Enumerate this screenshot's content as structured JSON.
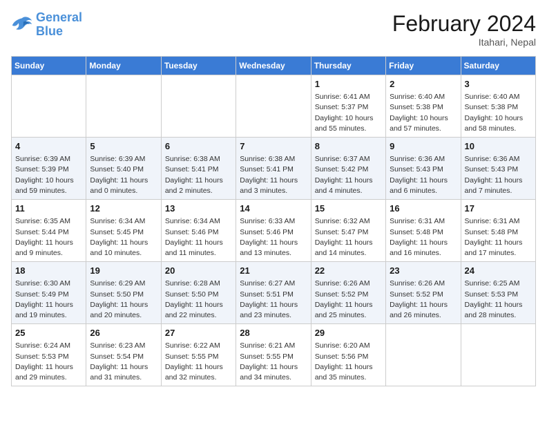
{
  "logo": {
    "text_general": "General",
    "text_blue": "Blue"
  },
  "title": "February 2024",
  "subtitle": "Itahari, Nepal",
  "days_of_week": [
    "Sunday",
    "Monday",
    "Tuesday",
    "Wednesday",
    "Thursday",
    "Friday",
    "Saturday"
  ],
  "weeks": [
    [
      {
        "day": "",
        "info": ""
      },
      {
        "day": "",
        "info": ""
      },
      {
        "day": "",
        "info": ""
      },
      {
        "day": "",
        "info": ""
      },
      {
        "day": "1",
        "info": "Sunrise: 6:41 AM\nSunset: 5:37 PM\nDaylight: 10 hours and 55 minutes."
      },
      {
        "day": "2",
        "info": "Sunrise: 6:40 AM\nSunset: 5:38 PM\nDaylight: 10 hours and 57 minutes."
      },
      {
        "day": "3",
        "info": "Sunrise: 6:40 AM\nSunset: 5:38 PM\nDaylight: 10 hours and 58 minutes."
      }
    ],
    [
      {
        "day": "4",
        "info": "Sunrise: 6:39 AM\nSunset: 5:39 PM\nDaylight: 10 hours and 59 minutes."
      },
      {
        "day": "5",
        "info": "Sunrise: 6:39 AM\nSunset: 5:40 PM\nDaylight: 11 hours and 0 minutes."
      },
      {
        "day": "6",
        "info": "Sunrise: 6:38 AM\nSunset: 5:41 PM\nDaylight: 11 hours and 2 minutes."
      },
      {
        "day": "7",
        "info": "Sunrise: 6:38 AM\nSunset: 5:41 PM\nDaylight: 11 hours and 3 minutes."
      },
      {
        "day": "8",
        "info": "Sunrise: 6:37 AM\nSunset: 5:42 PM\nDaylight: 11 hours and 4 minutes."
      },
      {
        "day": "9",
        "info": "Sunrise: 6:36 AM\nSunset: 5:43 PM\nDaylight: 11 hours and 6 minutes."
      },
      {
        "day": "10",
        "info": "Sunrise: 6:36 AM\nSunset: 5:43 PM\nDaylight: 11 hours and 7 minutes."
      }
    ],
    [
      {
        "day": "11",
        "info": "Sunrise: 6:35 AM\nSunset: 5:44 PM\nDaylight: 11 hours and 9 minutes."
      },
      {
        "day": "12",
        "info": "Sunrise: 6:34 AM\nSunset: 5:45 PM\nDaylight: 11 hours and 10 minutes."
      },
      {
        "day": "13",
        "info": "Sunrise: 6:34 AM\nSunset: 5:46 PM\nDaylight: 11 hours and 11 minutes."
      },
      {
        "day": "14",
        "info": "Sunrise: 6:33 AM\nSunset: 5:46 PM\nDaylight: 11 hours and 13 minutes."
      },
      {
        "day": "15",
        "info": "Sunrise: 6:32 AM\nSunset: 5:47 PM\nDaylight: 11 hours and 14 minutes."
      },
      {
        "day": "16",
        "info": "Sunrise: 6:31 AM\nSunset: 5:48 PM\nDaylight: 11 hours and 16 minutes."
      },
      {
        "day": "17",
        "info": "Sunrise: 6:31 AM\nSunset: 5:48 PM\nDaylight: 11 hours and 17 minutes."
      }
    ],
    [
      {
        "day": "18",
        "info": "Sunrise: 6:30 AM\nSunset: 5:49 PM\nDaylight: 11 hours and 19 minutes."
      },
      {
        "day": "19",
        "info": "Sunrise: 6:29 AM\nSunset: 5:50 PM\nDaylight: 11 hours and 20 minutes."
      },
      {
        "day": "20",
        "info": "Sunrise: 6:28 AM\nSunset: 5:50 PM\nDaylight: 11 hours and 22 minutes."
      },
      {
        "day": "21",
        "info": "Sunrise: 6:27 AM\nSunset: 5:51 PM\nDaylight: 11 hours and 23 minutes."
      },
      {
        "day": "22",
        "info": "Sunrise: 6:26 AM\nSunset: 5:52 PM\nDaylight: 11 hours and 25 minutes."
      },
      {
        "day": "23",
        "info": "Sunrise: 6:26 AM\nSunset: 5:52 PM\nDaylight: 11 hours and 26 minutes."
      },
      {
        "day": "24",
        "info": "Sunrise: 6:25 AM\nSunset: 5:53 PM\nDaylight: 11 hours and 28 minutes."
      }
    ],
    [
      {
        "day": "25",
        "info": "Sunrise: 6:24 AM\nSunset: 5:53 PM\nDaylight: 11 hours and 29 minutes."
      },
      {
        "day": "26",
        "info": "Sunrise: 6:23 AM\nSunset: 5:54 PM\nDaylight: 11 hours and 31 minutes."
      },
      {
        "day": "27",
        "info": "Sunrise: 6:22 AM\nSunset: 5:55 PM\nDaylight: 11 hours and 32 minutes."
      },
      {
        "day": "28",
        "info": "Sunrise: 6:21 AM\nSunset: 5:55 PM\nDaylight: 11 hours and 34 minutes."
      },
      {
        "day": "29",
        "info": "Sunrise: 6:20 AM\nSunset: 5:56 PM\nDaylight: 11 hours and 35 minutes."
      },
      {
        "day": "",
        "info": ""
      },
      {
        "day": "",
        "info": ""
      }
    ]
  ]
}
